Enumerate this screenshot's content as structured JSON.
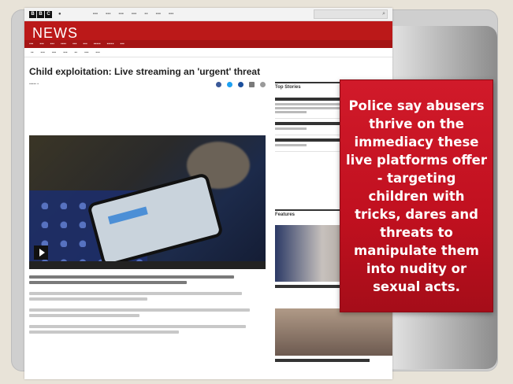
{
  "article": {
    "headline": "Child exploitation: Live streaming an 'urgent' threat"
  },
  "site": {
    "brand_letters": [
      "B",
      "B",
      "C"
    ],
    "section_title": "NEWS"
  },
  "sidebar": {
    "top_stories_heading": "Top Stories",
    "features_heading": "Features"
  },
  "callout": {
    "text": "Police say abusers thrive on the immediacy these live platforms offer - targeting children with tricks, dares and threats to manipulate them into nudity or sexual acts."
  },
  "colors": {
    "bbc_red": "#bb1919",
    "callout_red": "#c0101f"
  }
}
